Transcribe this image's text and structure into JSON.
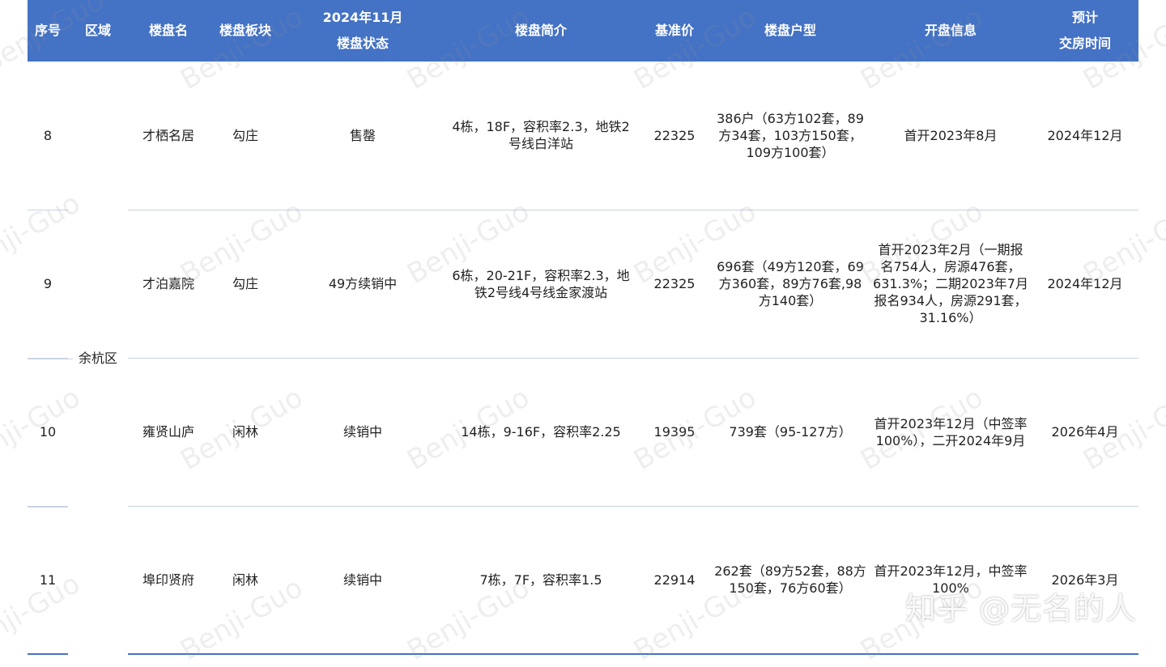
{
  "header": {
    "seq": "序号",
    "region": "区域",
    "name": "楼盘名",
    "block": "楼盘板块",
    "status_line1": "2024年11月",
    "status_line2": "楼盘状态",
    "intro": "楼盘简介",
    "price": "基准价",
    "units": "楼盘户型",
    "opening": "开盘信息",
    "delivery_line1": "预计",
    "delivery_line2": "交房时间"
  },
  "region_name": "余杭区",
  "rows": [
    {
      "seq": "8",
      "name": "才栖名居",
      "block": "勾庄",
      "status": "售罄",
      "intro": "4栋，18F，容积率2.3，地铁2号线白洋站",
      "price": "22325",
      "units": "386户（63方102套，89方34套，103方150套，109方100套）",
      "opening": "首开2023年8月",
      "delivery": "2024年12月"
    },
    {
      "seq": "9",
      "name": "才泊嘉院",
      "block": "勾庄",
      "status": "49方续销中",
      "intro": "6栋，20-21F，容积率2.3，地铁2号线4号线金家渡站",
      "price": "22325",
      "units": "696套（49方120套，69方360套，89方76套,98方140套）",
      "opening": "首开2023年2月（一期报名754人，房源476套，631.3%；二期2023年7月报名934人，房源291套，31.16%）",
      "delivery": "2024年12月"
    },
    {
      "seq": "10",
      "name": "雍贤山庐",
      "block": "闲林",
      "status": "续销中",
      "intro": "14栋，9-16F，容积率2.25",
      "price": "19395",
      "units": "739套（95-127方）",
      "opening": "首开2023年12月（中签率100%），二开2024年9月",
      "delivery": "2026年4月"
    },
    {
      "seq": "11",
      "name": "埠印贤府",
      "block": "闲林",
      "status": "续销中",
      "intro": "7栋，7F，容积率1.5",
      "price": "22914",
      "units": "262套（89方52套，88方150套，76方60套）",
      "opening": "首开2023年12月，中签率100%",
      "delivery": "2026年3月"
    }
  ],
  "watermark_text": "Benji-Guo",
  "zhihu_mark": "知乎 @无名的人"
}
